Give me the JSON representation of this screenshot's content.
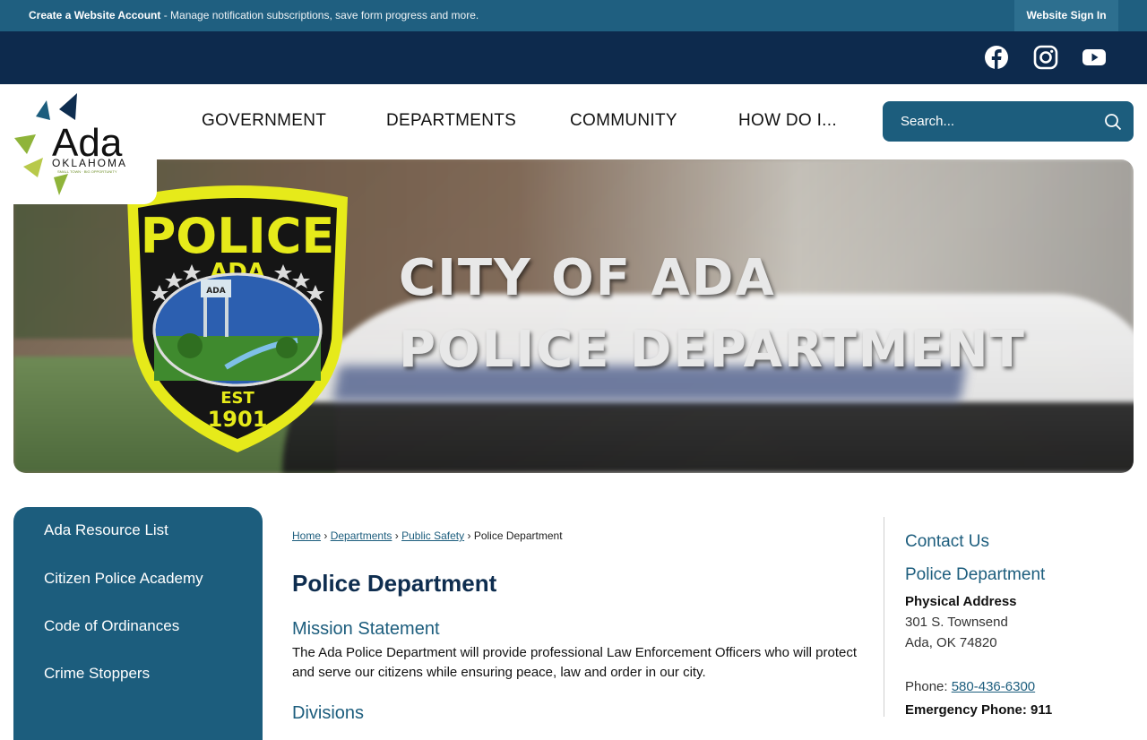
{
  "topbar": {
    "account_link": "Create a Website Account",
    "account_desc": " - Manage notification subscriptions, save form progress and more.",
    "signin": "Website Sign In"
  },
  "social": {
    "icons": [
      "facebook-icon",
      "instagram-icon",
      "youtube-icon"
    ]
  },
  "logo": {
    "name": "Ada",
    "state": "OKLAHOMA",
    "tagline": "SMALL TOWN · BIG OPPORTUNITY"
  },
  "nav": {
    "items": [
      "GOVERNMENT",
      "DEPARTMENTS",
      "COMMUNITY",
      "HOW DO I..."
    ]
  },
  "search": {
    "placeholder": "Search..."
  },
  "banner": {
    "line1": "CITY OF ADA",
    "line2": "POLICE DEPARTMENT",
    "badge": {
      "top": "POLICE",
      "city": "ADA",
      "tower": "ADA",
      "est": "EST",
      "year": "1901"
    }
  },
  "sidebar": {
    "items": [
      "Ada Resource List",
      "Citizen Police Academy",
      "Code of Ordinances",
      "Crime Stoppers"
    ]
  },
  "breadcrumb": {
    "items": [
      "Home",
      "Departments",
      "Public Safety"
    ],
    "current": "Police Department",
    "separator": "›"
  },
  "main": {
    "title": "Police Department",
    "mission_heading": "Mission Statement",
    "mission_text": "The Ada Police Department will provide professional Law Enforcement Officers who will protect and serve our citizens while ensuring peace, law and order in our city.",
    "divisions_heading": "Divisions"
  },
  "contact": {
    "heading": "Contact Us",
    "dept": "Police Department",
    "address_label": "Physical Address",
    "address_line1": "301 S. Townsend",
    "address_line2": "Ada, OK 74820",
    "phone_label": "Phone: ",
    "phone": "580-436-6300",
    "emergency": "Emergency Phone: 911"
  },
  "colors": {
    "topbar": "#1f5f80",
    "socialbar": "#0d2a4d",
    "accent": "#1c5d7d",
    "badge_yellow": "#e6ea1a"
  }
}
